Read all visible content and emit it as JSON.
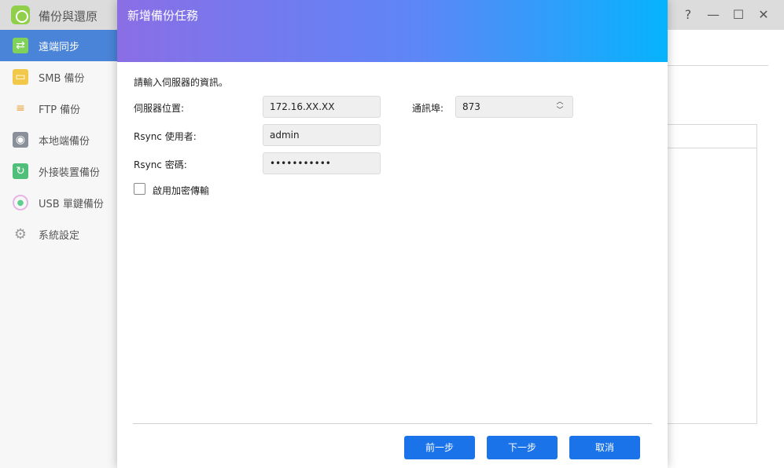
{
  "app": {
    "title": "備份與還原",
    "controls": {
      "help": "?",
      "minimize": "—",
      "maximize": "☐",
      "close": "✕"
    }
  },
  "sidebar": {
    "items": [
      {
        "label": "遠端同步",
        "icon": "sync-icon",
        "active": true
      },
      {
        "label": "SMB 備份",
        "icon": "smb-folder-icon"
      },
      {
        "label": "FTP 備份",
        "icon": "ftp-icon"
      },
      {
        "label": "本地端備份",
        "icon": "local-disk-icon"
      },
      {
        "label": "外接裝置備份",
        "icon": "external-device-icon"
      },
      {
        "label": "USB 單鍵備份",
        "icon": "usb-button-icon"
      },
      {
        "label": "系統設定",
        "icon": "gear-icon"
      }
    ]
  },
  "dialog": {
    "title": "新增備份任務",
    "intro": "請輸入伺服器的資訊。",
    "server_label": "伺服器位置:",
    "server_value": "172.16.XX.XX",
    "port_label": "通訊埠:",
    "port_value": "873",
    "user_label": "Rsync 使用者:",
    "user_value": "admin",
    "password_label": "Rsync 密碼:",
    "password_value": "•••••••••••",
    "encrypt_label": "啟用加密傳輸",
    "buttons": {
      "prev": "前一步",
      "next": "下一步",
      "cancel": "取消"
    }
  },
  "colors": {
    "accent": "#1a73e8",
    "sidebar_active": "#4a84d8",
    "header_gradient_start": "#8a6ee6",
    "header_gradient_end": "#06b3fd"
  }
}
